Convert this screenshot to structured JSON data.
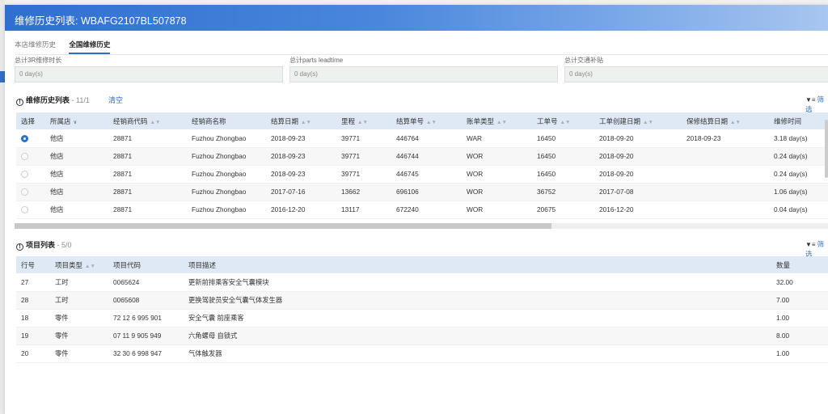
{
  "dialog": {
    "title": "维修历史列表: WBAFG2107BL507878"
  },
  "tabs": [
    {
      "label": "本店维修历史",
      "active": false
    },
    {
      "label": "全国维修历史",
      "active": true
    }
  ],
  "totals": [
    {
      "label": "总计3R维修时长",
      "value": "0 day(s)"
    },
    {
      "label": "总计parts leadtime",
      "value": "0 day(s)"
    },
    {
      "label": "总计交通补贴",
      "value": "0 day(s)"
    }
  ],
  "history": {
    "title": "维修历史列表",
    "count": "- 11/1",
    "clear_label": "清空",
    "filter_label": "筛选",
    "columns": [
      "选择",
      "所属店",
      "经销商代码",
      "经销商名称",
      "结算日期",
      "里程",
      "结算单号",
      "账单类型",
      "工单号",
      "工单创建日期",
      "保修结算日期",
      "维修时间"
    ],
    "rows": [
      {
        "selected": true,
        "cells": [
          "他店",
          "28871",
          "Fuzhou Zhongbao",
          "2018-09-23",
          "39771",
          "446764",
          "WAR",
          "16450",
          "2018-09-20",
          "2018-09-23",
          "3.18 day(s)"
        ]
      },
      {
        "selected": false,
        "cells": [
          "他店",
          "28871",
          "Fuzhou Zhongbao",
          "2018-09-23",
          "39771",
          "446744",
          "WOR",
          "16450",
          "2018-09-20",
          "",
          "0.24 day(s)"
        ]
      },
      {
        "selected": false,
        "cells": [
          "他店",
          "28871",
          "Fuzhou Zhongbao",
          "2018-09-23",
          "39771",
          "446745",
          "WOR",
          "16450",
          "2018-09-20",
          "",
          "0.24 day(s)"
        ]
      },
      {
        "selected": false,
        "cells": [
          "他店",
          "28871",
          "Fuzhou Zhongbao",
          "2017-07-16",
          "13662",
          "696106",
          "WOR",
          "36752",
          "2017-07-08",
          "",
          "1.06 day(s)"
        ]
      },
      {
        "selected": false,
        "cells": [
          "他店",
          "28871",
          "Fuzhou Zhongbao",
          "2016-12-20",
          "13117",
          "672240",
          "WOR",
          "20675",
          "2016-12-20",
          "",
          "0.04 day(s)"
        ]
      }
    ]
  },
  "items": {
    "title": "项目列表",
    "count": "- 5/0",
    "filter_label": "筛选",
    "columns": [
      "行号",
      "项目类型",
      "项目代码",
      "项目描述",
      "数量"
    ],
    "rows": [
      [
        "27",
        "工时",
        "0065624",
        "更新前排乘客安全气囊模块",
        "32.00"
      ],
      [
        "28",
        "工时",
        "0065608",
        "更换驾驶员安全气囊气体发生器",
        "7.00"
      ],
      [
        "18",
        "零件",
        "72 12 6 995 901",
        "安全气囊 前座乘客",
        "1.00"
      ],
      [
        "19",
        "零件",
        "07 11 9 905 949",
        "六角螺母 自锁式",
        "8.00"
      ],
      [
        "20",
        "零件",
        "32 30 6 998 947",
        "气体触发器",
        "1.00"
      ]
    ]
  }
}
